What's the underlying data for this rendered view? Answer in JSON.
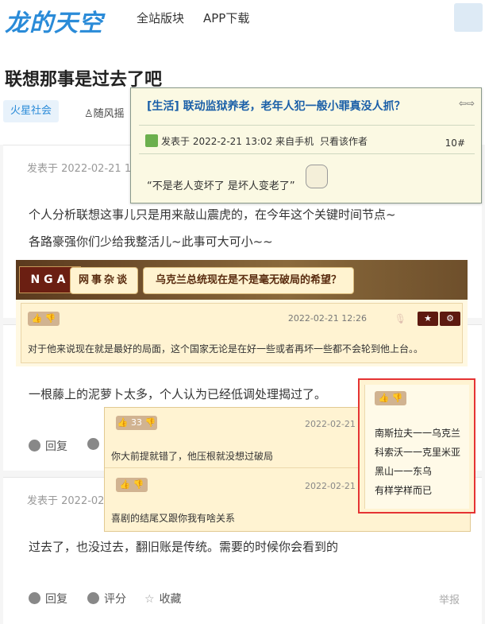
{
  "header": {
    "logo": "龙的天空",
    "nav": [
      "全站版块",
      "APP下载"
    ]
  },
  "thread": {
    "title": "联想那事是过去了吧",
    "tag": "火星社会",
    "author": "随风摇"
  },
  "posts": [
    {
      "date": "发表于 2022-02-21 1",
      "lines": [
        "个人分析联想这事儿只是用来敲山震虎的，在今年这个关键时间节点~",
        "各路豪强你们少给我整活儿~此事可大可小~~"
      ]
    },
    {
      "text": "一根藤上的泥萝卜太多，个人认为已经低调处理揭过了。",
      "actions": {
        "reply": "回复"
      }
    },
    {
      "date": "发表于 2022-02",
      "text": "过去了，也没过去，翻旧账是传统。需要的时候你会看到的",
      "actions": {
        "reply": "回复",
        "rate": "评分",
        "favorite": "收藏",
        "report": "举报"
      }
    }
  ],
  "nga": {
    "logo": "NGA",
    "crumbs": [
      "网事杂谈",
      "乌克兰总统现在是不是毫无破局的希望？"
    ],
    "date": "2022-02-21 12:26",
    "text": "对于他来说现在就是最好的局面，这个国家无论是在好一些或者再坏一些都不会轮到他上台。。",
    "quotes": [
      {
        "likes": "33",
        "date": "2022-02-21",
        "text": "你大前提就错了，他压根就没想过破局"
      },
      {
        "date": "2022-02-21",
        "text": "喜剧的结尾又跟你我有啥关系"
      }
    ],
    "highlight": [
      "南斯拉夫一一乌克兰",
      "科索沃一一克里米亚",
      "黑山一一东乌",
      "有样学样而已"
    ]
  },
  "popup": {
    "title": "[生活] 联动监狱养老，老年人犯一般小罪真没人抓？",
    "arrows": "⇦⇨",
    "meta": "发表于 2022-2-21 13:02 来自手机",
    "only_author": "只看该作者",
    "floor": "10#",
    "text": "“不是老人变坏了 是坏人变老了”"
  }
}
